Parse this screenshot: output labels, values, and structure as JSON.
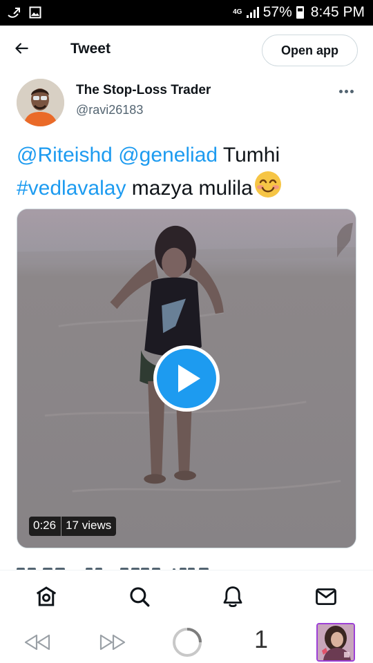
{
  "status_bar": {
    "network": "4G",
    "battery": "57%",
    "time": "8:45 PM"
  },
  "header": {
    "back_icon": "arrow-left-icon",
    "title": "Tweet",
    "open_app_label": "Open app"
  },
  "tweet": {
    "author": {
      "display_name": "The Stop-Loss Trader",
      "handle": "@ravi26183"
    },
    "more_icon": "more-options-icon",
    "text": {
      "mention_1": "@Riteishd",
      "mention_2": "@geneliad",
      "word_1": "Tumhi",
      "hashtag": "#vedlavalay",
      "rest": "mazya mulila",
      "emoji": "smiling-face-with-smiling-eyes-emoji"
    },
    "video": {
      "duration": "0:26",
      "views": "17 views",
      "play_icon": "play-icon"
    }
  },
  "tabbar": {
    "items": [
      {
        "name": "home",
        "icon": "home-icon"
      },
      {
        "name": "search",
        "icon": "search-icon"
      },
      {
        "name": "notifications",
        "icon": "bell-icon"
      },
      {
        "name": "messages",
        "icon": "mail-icon"
      }
    ]
  },
  "browser_nav": {
    "back_icon": "rewind-icon",
    "forward_icon": "fast-forward-icon",
    "loading_icon": "loading-spinner-icon",
    "tab_count": "1"
  },
  "colors": {
    "accent": "#1d9bf0",
    "text_primary": "#0f1419",
    "text_secondary": "#536471",
    "tab_thumb_border": "#9c3fd6"
  }
}
